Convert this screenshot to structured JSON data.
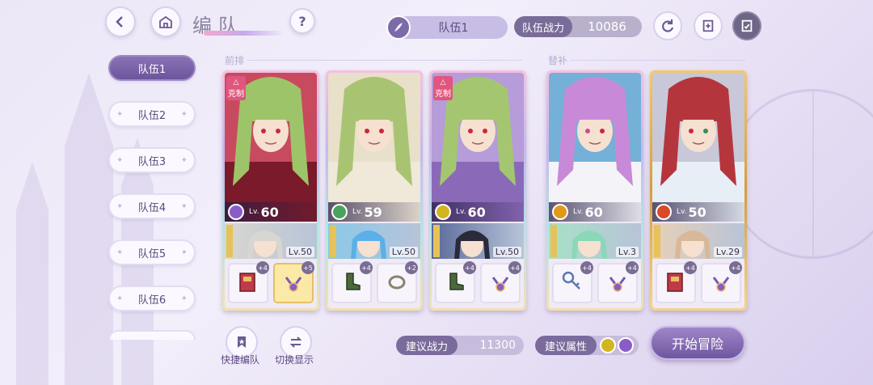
{
  "header": {
    "title": "编队",
    "current_team_label": "队伍1",
    "team_power_label": "队伍战力",
    "team_power_value": "10086"
  },
  "sidebar": {
    "tabs": [
      {
        "label": "队伍1",
        "active": true
      },
      {
        "label": "队伍2",
        "active": false
      },
      {
        "label": "队伍3",
        "active": false
      },
      {
        "label": "队伍4",
        "active": false
      },
      {
        "label": "队伍5",
        "active": false
      },
      {
        "label": "队伍6",
        "active": false
      }
    ]
  },
  "sections": {
    "front_label": "前排",
    "support_label": "替补"
  },
  "cards": [
    {
      "tag": "克制",
      "level_prefix": "Lv.",
      "level": "60",
      "element_color": "#8a5cc8",
      "sub_level": "Lv.50",
      "item1_badge": "+4",
      "item2_badge": "+5",
      "item1_icon": "book-icon",
      "item2_icon": "amulet-icon"
    },
    {
      "tag": "",
      "level_prefix": "Lv.",
      "level": "59",
      "element_color": "#4aa35a",
      "sub_level": "Lv.50",
      "item1_badge": "+4",
      "item2_badge": "+2",
      "item1_icon": "boot-icon",
      "item2_icon": "ring-icon"
    },
    {
      "tag": "克制",
      "level_prefix": "Lv.",
      "level": "60",
      "element_color": "#d2b620",
      "sub_level": "Lv.50",
      "item1_badge": "+4",
      "item2_badge": "+4",
      "item1_icon": "boot-icon",
      "item2_icon": "amulet-icon"
    },
    {
      "tag": "",
      "level_prefix": "Lv.",
      "level": "60",
      "element_color": "#e09a1a",
      "sub_level": "Lv.3",
      "item1_badge": "+4",
      "item2_badge": "+4",
      "item1_icon": "key-icon",
      "item2_icon": "amulet-icon"
    },
    {
      "tag": "",
      "level_prefix": "Lv.",
      "level": "50",
      "element_color": "#d84a2a",
      "sub_level": "Lv.29",
      "item1_badge": "+4",
      "item2_badge": "+4",
      "item1_icon": "book-icon",
      "item2_icon": "amulet-icon"
    }
  ],
  "footer": {
    "quick_team_label": "快捷编队",
    "switch_view_label": "切换显示",
    "suggested_power_label": "建议战力",
    "suggested_power_value": "11300",
    "suggested_attr_label": "建议属性",
    "start_label": "开始冒险"
  },
  "colors": {
    "accent": "#7a63a8",
    "tag_red": "#e0567e"
  }
}
